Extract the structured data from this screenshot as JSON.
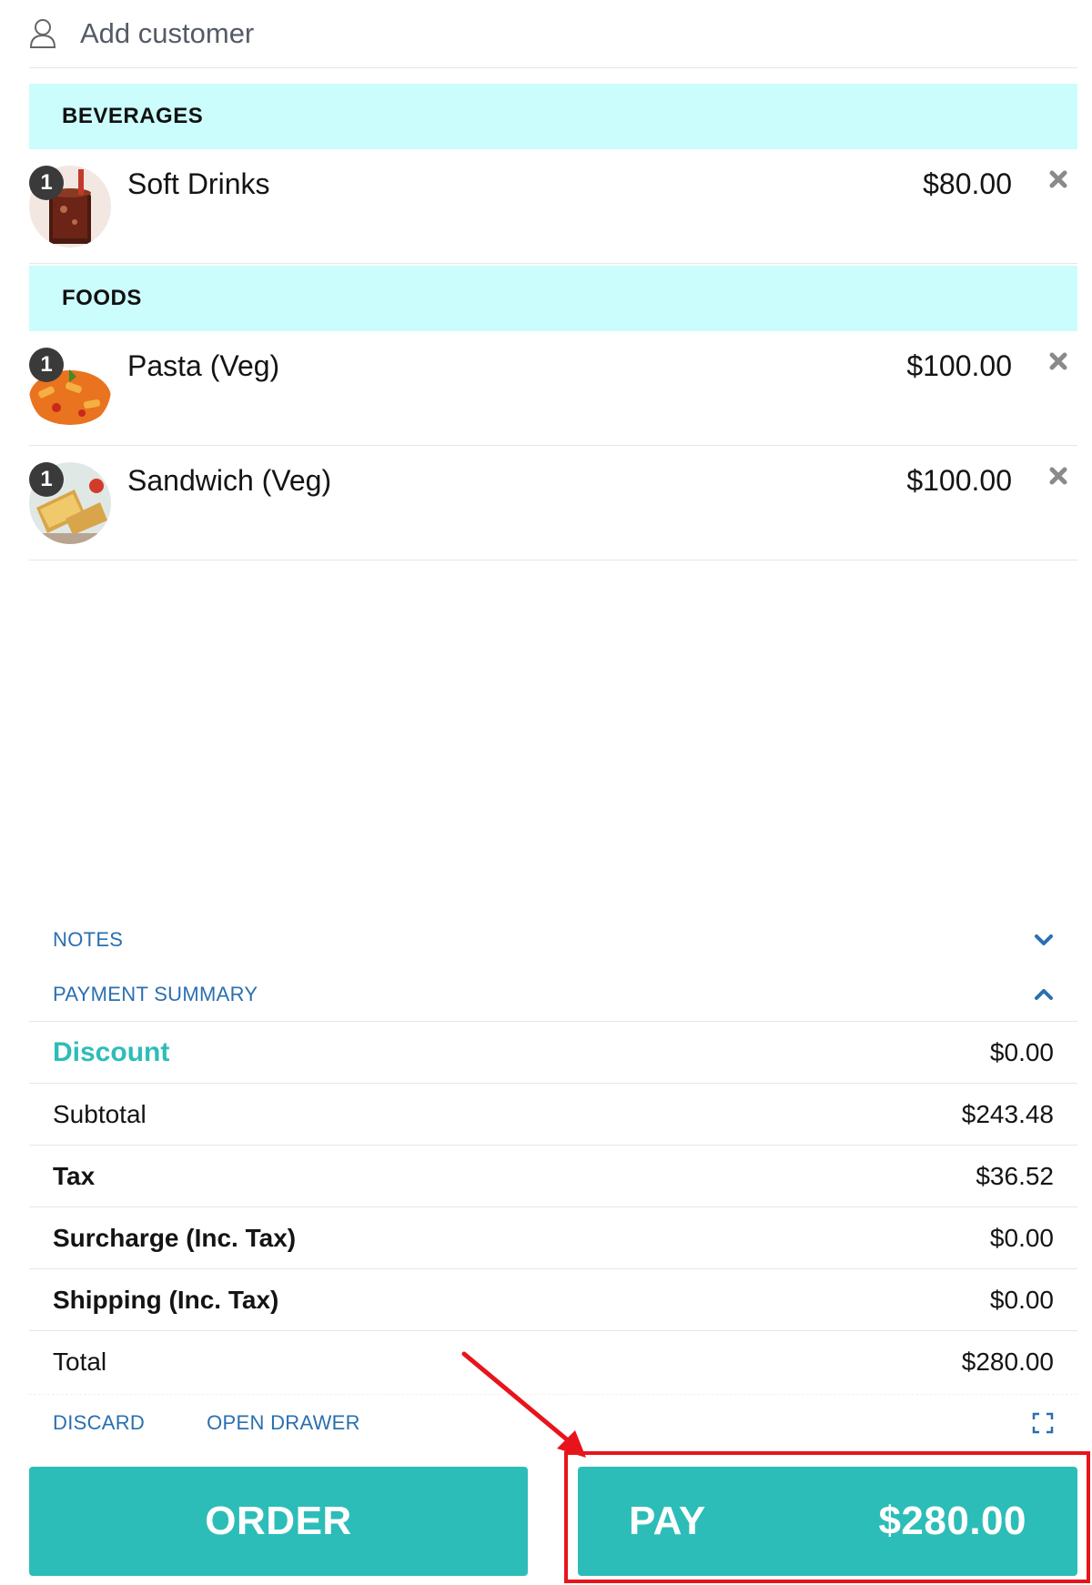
{
  "customer": {
    "label": "Add customer",
    "icon": "user-icon"
  },
  "categories": [
    {
      "name": "BEVERAGES",
      "items": [
        {
          "qty": "1",
          "name": "Soft Drinks",
          "price": "$80.00",
          "image": "soft-drinks-thumbnail"
        }
      ]
    },
    {
      "name": "FOODS",
      "items": [
        {
          "qty": "1",
          "name": "Pasta (Veg)",
          "price": "$100.00",
          "image": "pasta-thumbnail"
        },
        {
          "qty": "1",
          "name": "Sandwich (Veg)",
          "price": "$100.00",
          "image": "sandwich-thumbnail"
        }
      ]
    }
  ],
  "notes": {
    "label": "NOTES",
    "icon": "chevron-down-icon"
  },
  "payment_summary": {
    "label": "PAYMENT SUMMARY",
    "icon": "chevron-up-icon",
    "rows": [
      {
        "label": "Discount",
        "value": "$0.00"
      },
      {
        "label": "Subtotal",
        "value": "$243.48"
      },
      {
        "label": "Tax",
        "value": "$36.52"
      },
      {
        "label": "Surcharge (Inc. Tax)",
        "value": "$0.00"
      },
      {
        "label": "Shipping (Inc. Tax)",
        "value": "$0.00"
      },
      {
        "label": "Total",
        "value": "$280.00"
      }
    ]
  },
  "actions": {
    "discard": "DISCARD",
    "open_drawer": "OPEN DRAWER",
    "expand_icon": "fullscreen-icon"
  },
  "buttons": {
    "order": "ORDER",
    "pay_label": "PAY",
    "pay_amount": "$280.00"
  },
  "colors": {
    "accent": "#2dbdb8",
    "category_bg": "#ccfdfd",
    "link": "#2a6fb0",
    "annotation": "#e8141b"
  }
}
